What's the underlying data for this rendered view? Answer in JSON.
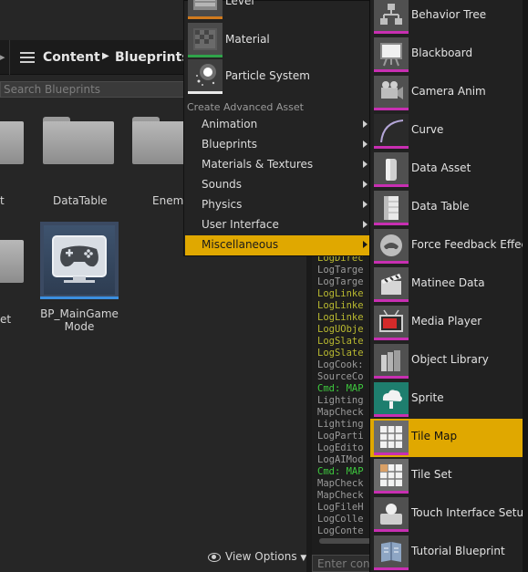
{
  "content_browser": {
    "path": [
      "Content",
      "Blueprints"
    ],
    "search_placeholder": "Search Blueprints",
    "assets": [
      {
        "label": "t"
      },
      {
        "label": "DataTable"
      },
      {
        "label": "Enemy"
      },
      {
        "label": "et"
      },
      {
        "label": "BP_MainGame\nMode"
      }
    ],
    "view_options": "View Options"
  },
  "main_menu": {
    "top_assets": [
      {
        "label": "Level",
        "icon": "level-icon",
        "stripe": "#d07a1e"
      },
      {
        "label": "Material",
        "icon": "material-icon",
        "stripe": "#2fa34a"
      },
      {
        "label": "Particle System",
        "icon": "particle-system-icon",
        "stripe": "#e8e8e8"
      }
    ],
    "section_header": "Create Advanced Asset",
    "categories": [
      {
        "label": "Animation",
        "active": false
      },
      {
        "label": "Blueprints",
        "active": false
      },
      {
        "label": "Materials & Textures",
        "active": false
      },
      {
        "label": "Sounds",
        "active": false
      },
      {
        "label": "Physics",
        "active": false
      },
      {
        "label": "User Interface",
        "active": false
      },
      {
        "label": "Miscellaneous",
        "active": true
      }
    ]
  },
  "misc_menu": {
    "items": [
      {
        "label": "Behavior Tree",
        "icon": "behavior-tree-icon",
        "active": false
      },
      {
        "label": "Blackboard",
        "icon": "blackboard-icon",
        "active": false
      },
      {
        "label": "Camera Anim",
        "icon": "camera-icon",
        "active": false
      },
      {
        "label": "Curve",
        "icon": "curve-icon",
        "active": false
      },
      {
        "label": "Data Asset",
        "icon": "data-asset-icon",
        "active": false
      },
      {
        "label": "Data Table",
        "icon": "data-table-icon",
        "active": false
      },
      {
        "label": "Force Feedback Effect",
        "icon": "force-feedback-icon",
        "active": false
      },
      {
        "label": "Matinee Data",
        "icon": "clapperboard-icon",
        "active": false
      },
      {
        "label": "Media Player",
        "icon": "tv-icon",
        "active": false
      },
      {
        "label": "Object Library",
        "icon": "object-library-icon",
        "active": false
      },
      {
        "label": "Sprite",
        "icon": "sprite-icon",
        "active": false
      },
      {
        "label": "Tile Map",
        "icon": "tile-map-icon",
        "active": true
      },
      {
        "label": "Tile Set",
        "icon": "tile-set-icon",
        "active": false
      },
      {
        "label": "Touch Interface Setup",
        "icon": "touch-interface-icon",
        "active": false
      },
      {
        "label": "Tutorial Blueprint",
        "icon": "tutorial-blueprint-icon",
        "active": false
      }
    ],
    "accent": "#c82fb2",
    "highlight": "#e0a800"
  },
  "output_log": {
    "lines": [
      {
        "text": "LogDirec",
        "color": "y"
      },
      {
        "text": "LogTarge",
        "color": ""
      },
      {
        "text": "LogTarge",
        "color": ""
      },
      {
        "text": "LogLinke",
        "color": "y"
      },
      {
        "text": "LogLinke",
        "color": "y"
      },
      {
        "text": "LogLinke",
        "color": "y"
      },
      {
        "text": "LogUObje",
        "color": "y"
      },
      {
        "text": "LogSlate",
        "color": "y"
      },
      {
        "text": "LogSlate",
        "color": "y"
      },
      {
        "text": "LogCook:",
        "color": ""
      },
      {
        "text": "SourceCo",
        "color": ""
      },
      {
        "text": "Cmd: MAP",
        "color": "g"
      },
      {
        "text": "Lighting",
        "color": ""
      },
      {
        "text": "MapCheck",
        "color": ""
      },
      {
        "text": "Lighting",
        "color": ""
      },
      {
        "text": "LogParti",
        "color": ""
      },
      {
        "text": "LogEdito",
        "color": ""
      },
      {
        "text": "LogAIMod",
        "color": ""
      },
      {
        "text": "Cmd: MAP",
        "color": "g"
      },
      {
        "text": "MapCheck",
        "color": ""
      },
      {
        "text": "MapCheck",
        "color": ""
      },
      {
        "text": "LogFileH",
        "color": ""
      },
      {
        "text": "LogColle",
        "color": ""
      },
      {
        "text": "LogConte",
        "color": ""
      }
    ],
    "input_placeholder": "Enter cons"
  }
}
